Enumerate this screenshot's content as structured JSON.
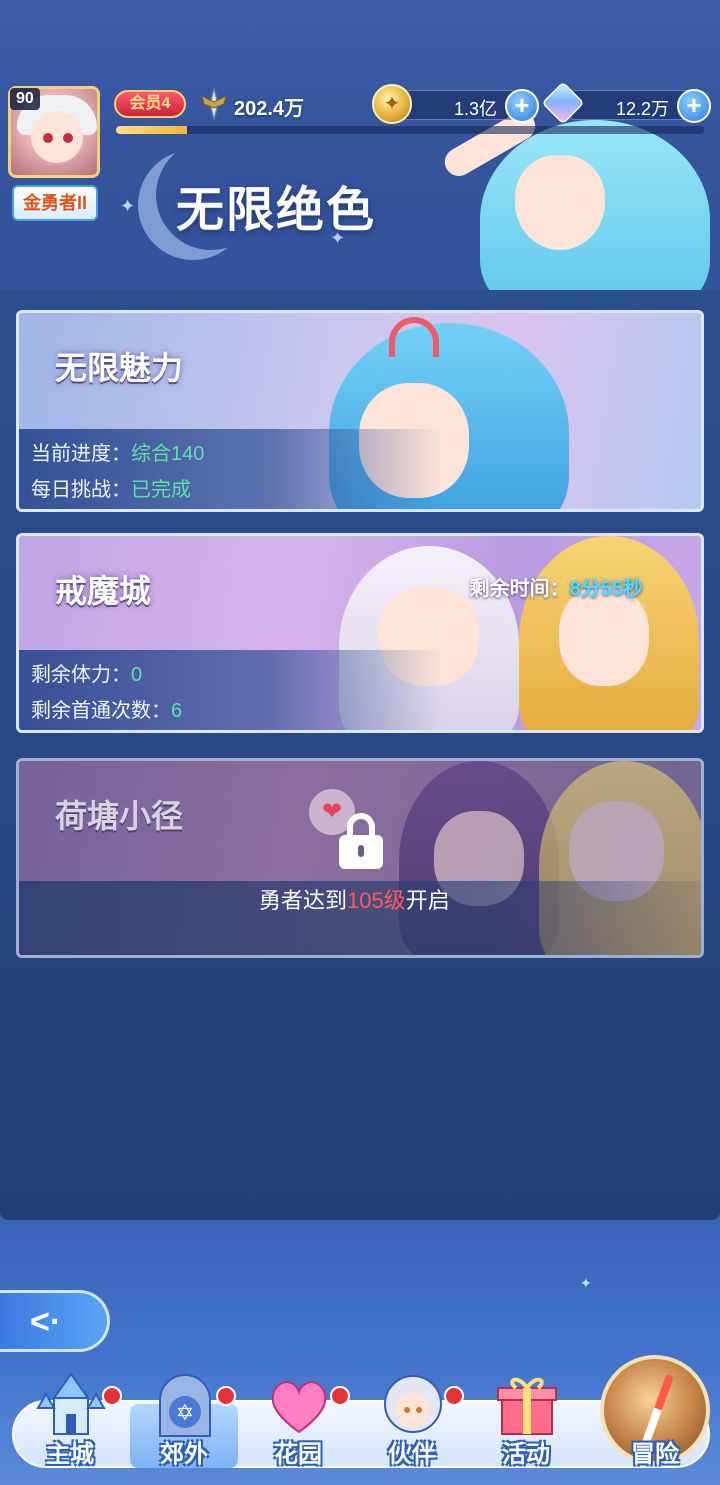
{
  "player": {
    "level": "90",
    "title_badge": "金勇者II",
    "vip": "会员4",
    "vip_progress": 0.12,
    "power": "202.4万"
  },
  "resources": {
    "gold": "1.3亿",
    "gems": "12.2万"
  },
  "page": {
    "title": "无限绝色"
  },
  "modes": [
    {
      "title": "无限魅力",
      "lines": [
        {
          "label": "当前进度：",
          "value": "综合140"
        },
        {
          "label": "每日挑战：",
          "value": "已完成"
        }
      ]
    },
    {
      "title": "戒魔城",
      "remain_time_label": "剩余时间：",
      "remain_time_value": "8分55秒",
      "lines": [
        {
          "label": "剩余体力：",
          "value": "0"
        },
        {
          "label": "剩余首通次数：",
          "value": "6"
        }
      ]
    },
    {
      "title": "荷塘小径",
      "locked": true,
      "unlock_prefix": "勇者达到",
      "unlock_level": "105级",
      "unlock_suffix": "开启"
    }
  ],
  "nav": [
    {
      "label": "主城",
      "icon": "castle-icon",
      "badge": true
    },
    {
      "label": "郊外",
      "icon": "portal-icon",
      "badge": true,
      "active": true
    },
    {
      "label": "花园",
      "icon": "heart-icon",
      "badge": true
    },
    {
      "label": "伙伴",
      "icon": "partner-icon",
      "badge": true
    },
    {
      "label": "活动",
      "icon": "gift-icon",
      "badge": false
    },
    {
      "label": "冒险",
      "icon": "compass-icon",
      "badge": false
    }
  ],
  "colors": {
    "accent_green": "#5ee0a8",
    "accent_cyan": "#48e0ff",
    "lock_level_red": "#ff5a60",
    "badge_red": "#e53238"
  }
}
